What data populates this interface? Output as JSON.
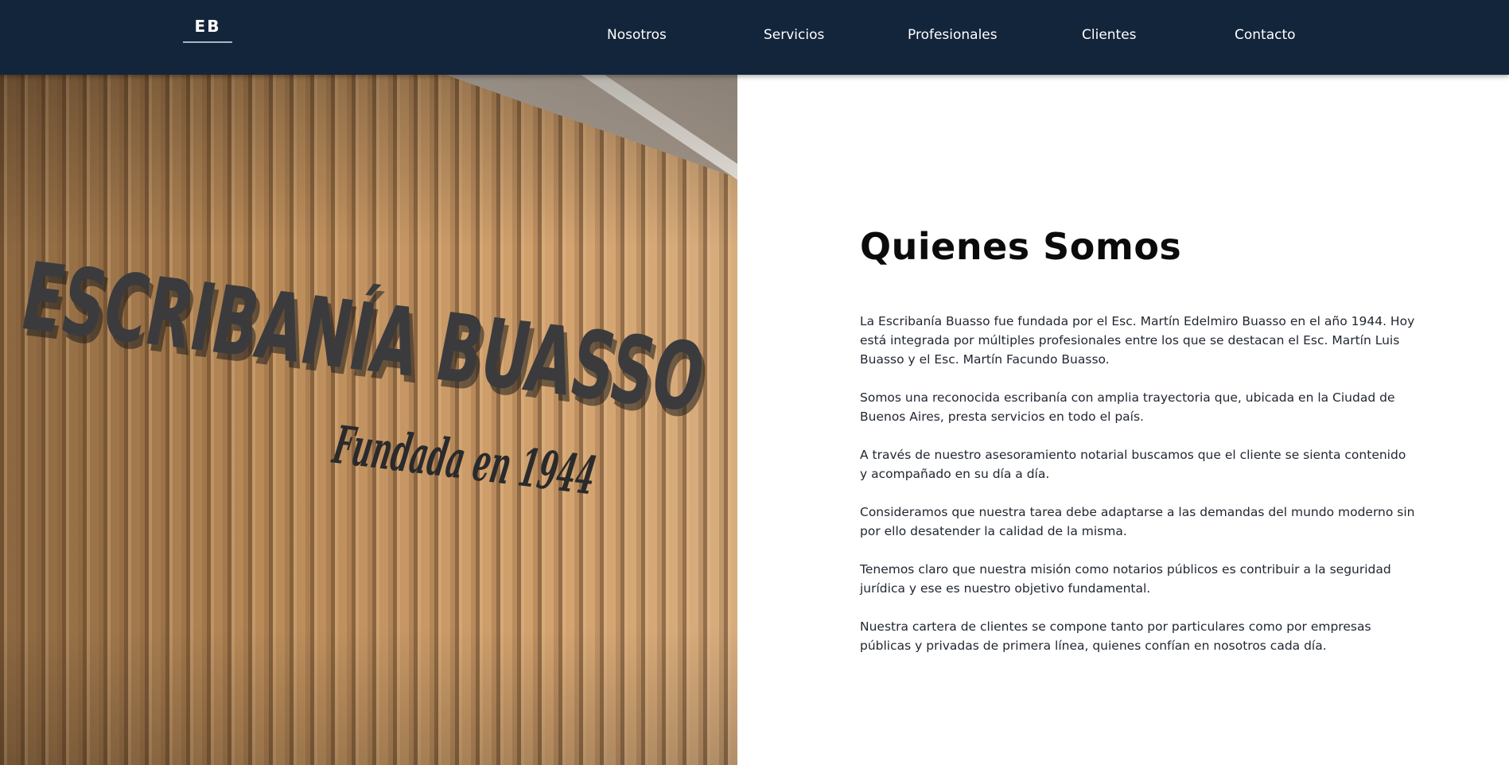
{
  "header": {
    "logo_text": "EB",
    "nav": [
      {
        "label": "Nosotros"
      },
      {
        "label": "Servicios"
      },
      {
        "label": "Profesionales"
      },
      {
        "label": "Clientes"
      },
      {
        "label": "Contacto"
      }
    ],
    "background_color": "#13253a"
  },
  "hero_image": {
    "sign_main": "ESCRIBANÍA BUASSO",
    "sign_sub": "Fundada en 1944"
  },
  "about": {
    "title": "Quienes Somos",
    "paragraphs": [
      "La Escribanía Buasso fue fundada por el Esc. Martín Edelmiro Buasso en el año 1944. Hoy está integrada por múltiples profesionales entre los que se destacan el Esc. Martín Luis Buasso y el Esc. Martín Facundo Buasso.",
      "Somos una reconocida escribanía con amplia trayectoria que, ubicada en la Ciudad de Buenos Aires, presta servicios en todo el país.",
      "A través de nuestro asesoramiento notarial buscamos que el cliente se sienta contenido y acompañado en su día a día.",
      "Consideramos que nuestra tarea debe adaptarse a las demandas del mundo moderno sin por ello desatender la calidad de la misma.",
      "Tenemos claro que nuestra misión como notarios públicos es contribuir a la seguridad jurídica y ese es nuestro objetivo fundamental.",
      "Nuestra cartera de clientes se compone tanto por particulares como por empresas públicas y privadas de primera línea, quienes confían en nosotros cada día."
    ]
  }
}
